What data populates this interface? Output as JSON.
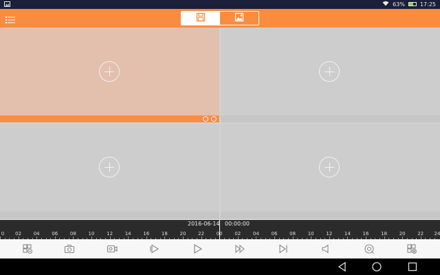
{
  "status_bar": {
    "battery_text": "63%",
    "battery_level": 0.63,
    "time": "17:25",
    "left_icon": "image-icon",
    "right_icons": [
      "wifi-icon",
      "battery-icon"
    ]
  },
  "toolbar": {
    "menu_icon": "menu-icon",
    "view_options": [
      {
        "icon": "video-file-icon",
        "active": true
      },
      {
        "icon": "picture-icon",
        "active": false
      }
    ]
  },
  "grid": {
    "cells": [
      {
        "selected": true,
        "icon": "add-circle-icon"
      },
      {
        "selected": false,
        "icon": "add-circle-icon"
      },
      {
        "selected": false,
        "icon": "add-circle-icon"
      },
      {
        "selected": false,
        "icon": "add-circle-icon"
      }
    ]
  },
  "timeline": {
    "date": "2016-06-14",
    "time": "00:00:00",
    "hour_labels": [
      "0",
      "02",
      "04",
      "06",
      "08",
      "10",
      "12",
      "14",
      "16",
      "18",
      "20",
      "22",
      "00",
      "02",
      "04",
      "06",
      "08",
      "10",
      "12",
      "14",
      "16",
      "18",
      "20",
      "22",
      "24"
    ]
  },
  "controls": {
    "buttons": [
      "channel-list-icon",
      "camera-icon",
      "record-video-icon",
      "play-slow-icon",
      "play-icon",
      "fast-forward-icon",
      "next-frame-icon",
      "volume-icon",
      "search-record-icon",
      "close-channel-icon"
    ]
  },
  "colors": {
    "accent": "#fa8c3f",
    "status_bar": "#1b1f3a",
    "timeline": "#2b2b2b",
    "cell": "#cdcdcd",
    "cell_selected": "#e3bfae"
  }
}
